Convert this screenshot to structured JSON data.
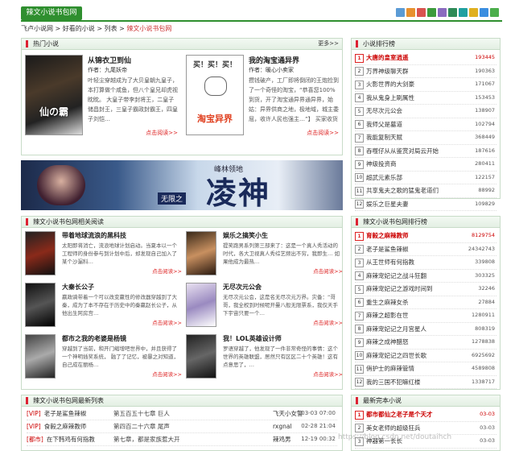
{
  "header": {
    "logo": "辣文小说书包网",
    "icons": [
      "home-icon",
      "rss-icon",
      "mail-icon",
      "bookmark-icon",
      "user-icon",
      "tree-icon",
      "gear-icon",
      "star-icon",
      "flag-icon",
      "list-icon"
    ]
  },
  "breadcrumb": [
    "飞卢小说网",
    "好看的小说",
    "列表",
    "辣文小说书包网"
  ],
  "hot": {
    "title": "热门小说",
    "more": "更多>>",
    "books": [
      {
        "title": "从锦衣卫到仙",
        "author": "作者：九尾妖帝",
        "desc": "叶轻尘穿越成为了大贝皇朝九皇子，本打算做个咸鱼，但八个皇兄却虎视眈眈。 大皇子带李封将王，二皇子储昌封王，三皇子霸政封霸王，四皇子刘恺…",
        "read": "点击阅读>>",
        "cover_text": "仙的霸人"
      },
      {
        "title": "我的淘宝通异界",
        "author": "作者：暖心小卖家",
        "desc": "攒钱破产，工厂即将倒闭的王炮捡到了一个奇怪的淘宝，“恭喜您100%到货，开了淘宝通异界通异界，始姑：异界供商之地，极地域，城主委屈，收许人民也强主…”】 买家收货状况…",
        "read": "点击阅读>>",
        "cover_text": "买！买！买！"
      }
    ]
  },
  "rank": {
    "title": "小说排行榜",
    "items": [
      {
        "num": "1",
        "name": "大唐的皇室逍遥",
        "count": "193445"
      },
      {
        "num": "2",
        "name": "万界神级聊天群",
        "count": "190363"
      },
      {
        "num": "3",
        "name": "火影世界的大剑豪",
        "count": "171067"
      },
      {
        "num": "4",
        "name": "我从鬼身上刷属性",
        "count": "153453"
      },
      {
        "num": "5",
        "name": "无尽次元公会",
        "count": "138907"
      },
      {
        "num": "6",
        "name": "我师父是墓道",
        "count": "102794"
      },
      {
        "num": "7",
        "name": "我能复制天赋",
        "count": "368449"
      },
      {
        "num": "8",
        "name": "吞噬仔从从鉴赏对局云开始",
        "count": "187616"
      },
      {
        "num": "9",
        "name": "神级投资商",
        "count": "280411"
      },
      {
        "num": "10",
        "name": "超武元素乐部",
        "count": "122157"
      },
      {
        "num": "11",
        "name": "共享鬼夫之歌的猛鬼老道们",
        "count": "88992"
      },
      {
        "num": "12",
        "name": "娱乐之巨星夫妻",
        "count": "109829"
      }
    ]
  },
  "banner": {
    "text": "峰林领地",
    "big": "凌神",
    "sub": "无限之"
  },
  "related": {
    "title": "辣文小说书包网相关阅读",
    "items": [
      {
        "title": "带着地球流浪的黑科技",
        "desc": "太阳即将消亡，流浪地球计划启动。当夏本以一个工程师的身份参与到计划中后，却发现自己加入了某个沙漏科…",
        "read": "点击阅读>>"
      },
      {
        "title": "娱乐之搞笑小生",
        "desc": "提笑跑男系列第三部来了：这是一个真人秀活动的时代，各大卫视真人秀综艺频出不穷，我即生… 如果他成为最热…",
        "read": "点击阅读>>"
      },
      {
        "title": "大秦长公子",
        "desc": "嬴政骑带着一个可以改变嬴性的修改器穿越到了大秦，成为了本不存在于历史中的秦嬴赵长公子，从他出生阿房宫…",
        "read": "点击阅读>>"
      },
      {
        "title": "无尽次元公会",
        "desc": "无尽次元公会，这是名无尽次元万界。灾备：“哥哥，我全权到时候呢开曼八般无限票系，我仅天手下宇宙只要一个…",
        "read": "点击阅读>>"
      },
      {
        "title": "都市之我的老婆是杨镜",
        "desc": "穿越到了当前，和开门缩增吧世界中，并且获得了一个神明插奖系统， 融了了记忆，被暴之对知道，自己成在丽杨…",
        "read": "点击阅读>>"
      },
      {
        "title": "我！LOL英雄设计师",
        "desc": "罗语穿越了，他发现了一件非常奇怪的事情：这个世界的英雄联盟，居然只有区区二十个英雄！这有点意思了，…",
        "read": "点击阅读>>"
      }
    ]
  },
  "rank2": {
    "title": "辣文小说书包网排行榜",
    "items": [
      {
        "num": "1",
        "name": "育毅之麻辣教师",
        "count": "8129754"
      },
      {
        "num": "2",
        "name": "老子是鲨鱼辣椒",
        "count": "24342743"
      },
      {
        "num": "3",
        "name": "从王世师有何指教",
        "count": "339808"
      },
      {
        "num": "4",
        "name": "麻辣宠妃记之战斗狂翻",
        "count": "303325"
      },
      {
        "num": "5",
        "name": "麻辣宠妃记之游戏时间到",
        "count": "32246"
      },
      {
        "num": "6",
        "name": "重生之麻辣女杀",
        "count": "27884"
      },
      {
        "num": "7",
        "name": "麻辣之超影在世",
        "count": "1280911"
      },
      {
        "num": "8",
        "name": "麻辣宠妃记之月宫星人",
        "count": "808319"
      },
      {
        "num": "9",
        "name": "麻辣之成神醋怒",
        "count": "1278838"
      },
      {
        "num": "10",
        "name": "麻辣宠妃记之四世长歌",
        "count": "6925692"
      },
      {
        "num": "11",
        "name": "俏护士的麻辣管情",
        "count": "4589808"
      },
      {
        "num": "12",
        "name": "我的三国不犯嘛红楼",
        "count": "1338717"
      }
    ]
  },
  "updates": {
    "title": "辣文小说书包网最新列表",
    "rows": [
      {
        "tag": "[VIP]",
        "book": "老子是鲨鱼辣椒",
        "chapter": "第五百五十七章 巨人",
        "author": "飞天小女警",
        "date": "03-03 07:00"
      },
      {
        "tag": "[VIP]",
        "book": "食毅之麻辣教师",
        "chapter": "第四百二十六章 尾声",
        "author": "rxgnal",
        "date": "02-28 21:04"
      },
      {
        "tag": "[都市]",
        "book": "在下韩鸡有何指教",
        "chapter": "第七章，都是家族惹大开",
        "author": "辣鸡男",
        "date": "12-19 00:32"
      }
    ]
  },
  "newest": {
    "title": "最新完本小说",
    "items": [
      {
        "num": "1",
        "name": "都市都仙之老子是个天才",
        "date": "03-03"
      },
      {
        "num": "2",
        "name": "美女老师的超级狂兵",
        "date": "03-03"
      },
      {
        "num": "3",
        "name": "神器第一长长",
        "date": "03-03"
      }
    ]
  },
  "watermark": "https://blog.csdn.net/doutaihch"
}
